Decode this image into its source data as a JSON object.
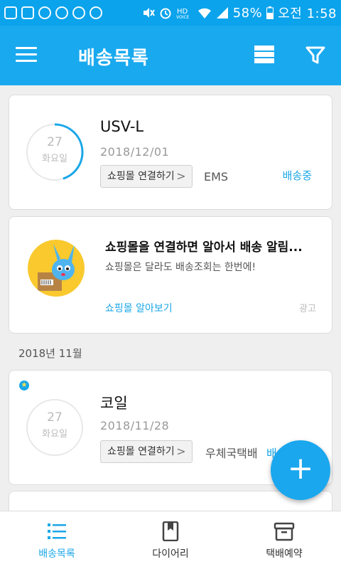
{
  "status_bar": {
    "battery": "58%",
    "time": "오전 1:58",
    "icons": [
      "message-icon",
      "facebook-icon",
      "saturn-icon",
      "app-icon",
      "app-icon",
      "talk-icon",
      "mute-icon",
      "alarm-icon",
      "hd-voice-icon",
      "wifi-icon",
      "signal-icon",
      "battery-icon"
    ]
  },
  "header": {
    "title": "배송목록",
    "icons": [
      "menu-icon",
      "list-icon",
      "filter-icon"
    ]
  },
  "shipments": [
    {
      "day": "27",
      "weekday": "화요일",
      "title": "USV-L",
      "date": "2018/12/01",
      "link_label": "쇼핑몰 연결하기",
      "courier": "EMS",
      "status": "배송중",
      "progress": 0.45
    },
    {
      "day": "27",
      "weekday": "화요일",
      "title": "코일",
      "date": "2018/11/28",
      "link_label": "쇼핑몰 연결하기",
      "courier": "우체국택배",
      "status": "배송",
      "progress": 0
    }
  ],
  "ad": {
    "title": "쇼핑몰을 연결하면 알아서 배송 알림...",
    "subtitle": "쇼핑몰은 달라도 배송조회는 한번에!",
    "link": "쇼핑몰 알아보기",
    "tag": "광고"
  },
  "month_header": "2018년 11월",
  "fab_label": "+",
  "bottom_nav": [
    {
      "label": "배송목록",
      "icon": "list-icon",
      "active": true
    },
    {
      "label": "다이어리",
      "icon": "bookmark-icon",
      "active": false
    },
    {
      "label": "택배예약",
      "icon": "box-icon",
      "active": false
    }
  ],
  "colors": {
    "primary": "#19a9ef",
    "status_bar": "#0aa3ec",
    "accent_text": "#1aa7e8",
    "background": "#efefef"
  }
}
